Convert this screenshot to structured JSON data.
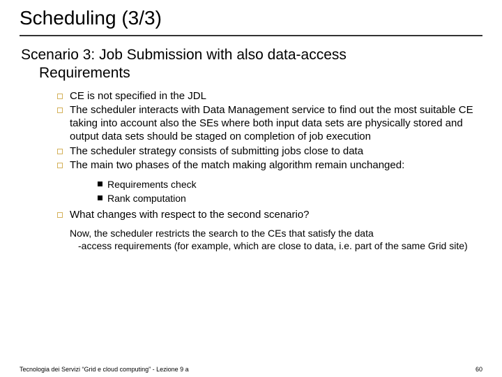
{
  "title": "Scheduling (3/3)",
  "subtitle_line1": "Scenario 3: Job Submission with also data-access",
  "subtitle_line2": "Requirements",
  "bullets": {
    "b1": "CE is not specified in the JDL",
    "b2": "The scheduler interacts with Data Management service to find out the most suitable CE taking into account also the SEs where both input data sets are physically stored and output data sets should be staged on completion of job execution",
    "b3": "The scheduler strategy consists of submitting jobs close to data",
    "b4": "The main two phases of the match making algorithm remain unchanged:"
  },
  "sub_bullets": {
    "s1": "Requirements check",
    "s2": "Rank computation"
  },
  "question": "What changes with respect to the second scenario?",
  "answer_lead": "Now, the scheduler restricts the search to the  CEs that satisfy the data",
  "answer_tail": "-access requirements (for example, which are close to data, i.e. part of the same Grid site)",
  "footer_left": "Tecnologia dei Servizi “Grid e cloud computing” - Lezione 9 a",
  "footer_right": "60"
}
